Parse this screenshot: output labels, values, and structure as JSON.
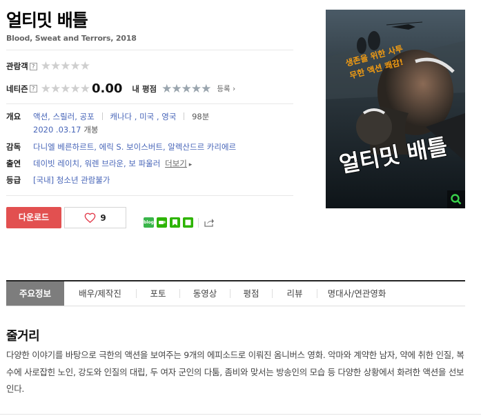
{
  "title": "얼티밋 배틀",
  "subtitle": "Blood, Sweat and Terrors, 2018",
  "ratings": {
    "audience_label": "관람객",
    "netizen_label": "네티즌",
    "help_mark": "?",
    "netizen_score": "0.00",
    "my_rating_label": "내 평점",
    "register_label": "등록",
    "stars": "★★★★★"
  },
  "info": {
    "overview_label": "개요",
    "genres": [
      "액션",
      "스릴러",
      "공포"
    ],
    "countries": [
      "캐나다",
      "미국",
      "영국"
    ],
    "runtime": "98분",
    "release_date": "2020 .03.17",
    "release_suffix": "개봉",
    "director_label": "감독",
    "directors": [
      "다니엘 베른하르트",
      "에릭 S. 보이스버트",
      "알렉산드르 카리에르"
    ],
    "cast_label": "출연",
    "cast": [
      "데이빗 레이치",
      "워렌 브라운",
      "보 파울러"
    ],
    "more_label": "더보기",
    "grade_label": "등급",
    "grade": "[국내] 청소년 관람불가"
  },
  "actions": {
    "download_label": "다운로드",
    "like_count": "9",
    "share_blog_label": "blog"
  },
  "poster": {
    "tagline_line1": "생존을 위한 사투",
    "tagline_line2": "무한 액션 쾌감!",
    "poster_title": "얼티밋 배틀"
  },
  "tabs": [
    "주요정보",
    "배우/제작진",
    "포토",
    "동영상",
    "평점",
    "리뷰",
    "명대사/연관영화"
  ],
  "synopsis": {
    "heading": "줄거리",
    "text": "다양한 이야기를 바탕으로 극한의 액션을 보여주는 9개의 에피소드로 이뤄진 옴니버스 영화. 악마와 계약한 남자, 약에 취한 인질, 복수에 사로잡힌 노인, 강도와 인질의 대립, 두 여자 군인의 다툼, 좀비와 맞서는 방송인의 모습 등 다양한 상황에서 화려한 액션을 선보인다."
  },
  "colors": {
    "download_red": "#e25050",
    "link_blue": "#4765b8",
    "active_tab": "#7d7d7d",
    "poster_orange": "#f39c12"
  }
}
